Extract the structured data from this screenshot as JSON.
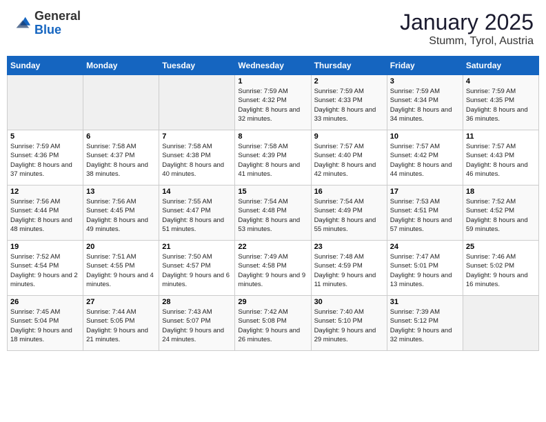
{
  "header": {
    "logo_general": "General",
    "logo_blue": "Blue",
    "month": "January 2025",
    "location": "Stumm, Tyrol, Austria"
  },
  "weekdays": [
    "Sunday",
    "Monday",
    "Tuesday",
    "Wednesday",
    "Thursday",
    "Friday",
    "Saturday"
  ],
  "weeks": [
    [
      {
        "day": "",
        "sunrise": "",
        "sunset": "",
        "daylight": ""
      },
      {
        "day": "",
        "sunrise": "",
        "sunset": "",
        "daylight": ""
      },
      {
        "day": "",
        "sunrise": "",
        "sunset": "",
        "daylight": ""
      },
      {
        "day": "1",
        "sunrise": "Sunrise: 7:59 AM",
        "sunset": "Sunset: 4:32 PM",
        "daylight": "Daylight: 8 hours and 32 minutes."
      },
      {
        "day": "2",
        "sunrise": "Sunrise: 7:59 AM",
        "sunset": "Sunset: 4:33 PM",
        "daylight": "Daylight: 8 hours and 33 minutes."
      },
      {
        "day": "3",
        "sunrise": "Sunrise: 7:59 AM",
        "sunset": "Sunset: 4:34 PM",
        "daylight": "Daylight: 8 hours and 34 minutes."
      },
      {
        "day": "4",
        "sunrise": "Sunrise: 7:59 AM",
        "sunset": "Sunset: 4:35 PM",
        "daylight": "Daylight: 8 hours and 36 minutes."
      }
    ],
    [
      {
        "day": "5",
        "sunrise": "Sunrise: 7:59 AM",
        "sunset": "Sunset: 4:36 PM",
        "daylight": "Daylight: 8 hours and 37 minutes."
      },
      {
        "day": "6",
        "sunrise": "Sunrise: 7:58 AM",
        "sunset": "Sunset: 4:37 PM",
        "daylight": "Daylight: 8 hours and 38 minutes."
      },
      {
        "day": "7",
        "sunrise": "Sunrise: 7:58 AM",
        "sunset": "Sunset: 4:38 PM",
        "daylight": "Daylight: 8 hours and 40 minutes."
      },
      {
        "day": "8",
        "sunrise": "Sunrise: 7:58 AM",
        "sunset": "Sunset: 4:39 PM",
        "daylight": "Daylight: 8 hours and 41 minutes."
      },
      {
        "day": "9",
        "sunrise": "Sunrise: 7:57 AM",
        "sunset": "Sunset: 4:40 PM",
        "daylight": "Daylight: 8 hours and 42 minutes."
      },
      {
        "day": "10",
        "sunrise": "Sunrise: 7:57 AM",
        "sunset": "Sunset: 4:42 PM",
        "daylight": "Daylight: 8 hours and 44 minutes."
      },
      {
        "day": "11",
        "sunrise": "Sunrise: 7:57 AM",
        "sunset": "Sunset: 4:43 PM",
        "daylight": "Daylight: 8 hours and 46 minutes."
      }
    ],
    [
      {
        "day": "12",
        "sunrise": "Sunrise: 7:56 AM",
        "sunset": "Sunset: 4:44 PM",
        "daylight": "Daylight: 8 hours and 48 minutes."
      },
      {
        "day": "13",
        "sunrise": "Sunrise: 7:56 AM",
        "sunset": "Sunset: 4:45 PM",
        "daylight": "Daylight: 8 hours and 49 minutes."
      },
      {
        "day": "14",
        "sunrise": "Sunrise: 7:55 AM",
        "sunset": "Sunset: 4:47 PM",
        "daylight": "Daylight: 8 hours and 51 minutes."
      },
      {
        "day": "15",
        "sunrise": "Sunrise: 7:54 AM",
        "sunset": "Sunset: 4:48 PM",
        "daylight": "Daylight: 8 hours and 53 minutes."
      },
      {
        "day": "16",
        "sunrise": "Sunrise: 7:54 AM",
        "sunset": "Sunset: 4:49 PM",
        "daylight": "Daylight: 8 hours and 55 minutes."
      },
      {
        "day": "17",
        "sunrise": "Sunrise: 7:53 AM",
        "sunset": "Sunset: 4:51 PM",
        "daylight": "Daylight: 8 hours and 57 minutes."
      },
      {
        "day": "18",
        "sunrise": "Sunrise: 7:52 AM",
        "sunset": "Sunset: 4:52 PM",
        "daylight": "Daylight: 8 hours and 59 minutes."
      }
    ],
    [
      {
        "day": "19",
        "sunrise": "Sunrise: 7:52 AM",
        "sunset": "Sunset: 4:54 PM",
        "daylight": "Daylight: 9 hours and 2 minutes."
      },
      {
        "day": "20",
        "sunrise": "Sunrise: 7:51 AM",
        "sunset": "Sunset: 4:55 PM",
        "daylight": "Daylight: 9 hours and 4 minutes."
      },
      {
        "day": "21",
        "sunrise": "Sunrise: 7:50 AM",
        "sunset": "Sunset: 4:57 PM",
        "daylight": "Daylight: 9 hours and 6 minutes."
      },
      {
        "day": "22",
        "sunrise": "Sunrise: 7:49 AM",
        "sunset": "Sunset: 4:58 PM",
        "daylight": "Daylight: 9 hours and 9 minutes."
      },
      {
        "day": "23",
        "sunrise": "Sunrise: 7:48 AM",
        "sunset": "Sunset: 4:59 PM",
        "daylight": "Daylight: 9 hours and 11 minutes."
      },
      {
        "day": "24",
        "sunrise": "Sunrise: 7:47 AM",
        "sunset": "Sunset: 5:01 PM",
        "daylight": "Daylight: 9 hours and 13 minutes."
      },
      {
        "day": "25",
        "sunrise": "Sunrise: 7:46 AM",
        "sunset": "Sunset: 5:02 PM",
        "daylight": "Daylight: 9 hours and 16 minutes."
      }
    ],
    [
      {
        "day": "26",
        "sunrise": "Sunrise: 7:45 AM",
        "sunset": "Sunset: 5:04 PM",
        "daylight": "Daylight: 9 hours and 18 minutes."
      },
      {
        "day": "27",
        "sunrise": "Sunrise: 7:44 AM",
        "sunset": "Sunset: 5:05 PM",
        "daylight": "Daylight: 9 hours and 21 minutes."
      },
      {
        "day": "28",
        "sunrise": "Sunrise: 7:43 AM",
        "sunset": "Sunset: 5:07 PM",
        "daylight": "Daylight: 9 hours and 24 minutes."
      },
      {
        "day": "29",
        "sunrise": "Sunrise: 7:42 AM",
        "sunset": "Sunset: 5:08 PM",
        "daylight": "Daylight: 9 hours and 26 minutes."
      },
      {
        "day": "30",
        "sunrise": "Sunrise: 7:40 AM",
        "sunset": "Sunset: 5:10 PM",
        "daylight": "Daylight: 9 hours and 29 minutes."
      },
      {
        "day": "31",
        "sunrise": "Sunrise: 7:39 AM",
        "sunset": "Sunset: 5:12 PM",
        "daylight": "Daylight: 9 hours and 32 minutes."
      },
      {
        "day": "",
        "sunrise": "",
        "sunset": "",
        "daylight": ""
      }
    ]
  ]
}
